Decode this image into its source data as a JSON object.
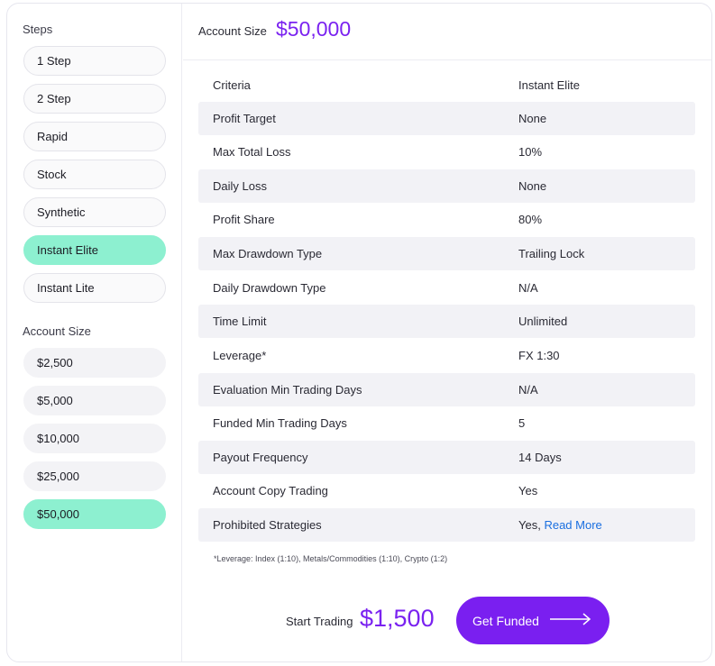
{
  "sidebar": {
    "steps_label": "Steps",
    "steps": [
      {
        "label": "1 Step",
        "active": false
      },
      {
        "label": "2 Step",
        "active": false
      },
      {
        "label": "Rapid",
        "active": false
      },
      {
        "label": "Stock",
        "active": false
      },
      {
        "label": "Synthetic",
        "active": false
      },
      {
        "label": "Instant Elite",
        "active": true
      },
      {
        "label": "Instant Lite",
        "active": false
      }
    ],
    "sizes_label": "Account Size",
    "sizes": [
      {
        "label": "$2,500",
        "active": false
      },
      {
        "label": "$5,000",
        "active": false
      },
      {
        "label": "$10,000",
        "active": false
      },
      {
        "label": "$25,000",
        "active": false
      },
      {
        "label": "$50,000",
        "active": true
      }
    ]
  },
  "header": {
    "label": "Account Size",
    "value": "$50,000"
  },
  "table": {
    "rows": [
      {
        "key": "Criteria",
        "value": "Instant Elite"
      },
      {
        "key": "Profit Target",
        "value": "None"
      },
      {
        "key": "Max Total Loss",
        "value": "10%"
      },
      {
        "key": "Daily Loss",
        "value": "None"
      },
      {
        "key": "Profit Share",
        "value": "80%"
      },
      {
        "key": "Max Drawdown Type",
        "value": "Trailing Lock"
      },
      {
        "key": "Daily Drawdown Type",
        "value": "N/A"
      },
      {
        "key": "Time Limit",
        "value": "Unlimited"
      },
      {
        "key": "Leverage*",
        "value": "FX 1:30"
      },
      {
        "key": "Evaluation Min Trading Days",
        "value": "N/A"
      },
      {
        "key": "Funded Min Trading Days",
        "value": "5"
      },
      {
        "key": "Payout Frequency",
        "value": "14 Days"
      },
      {
        "key": "Account Copy Trading",
        "value": "Yes"
      },
      {
        "key": "Prohibited Strategies",
        "value": "Yes,",
        "link": "Read More"
      }
    ]
  },
  "footnote": "*Leverage: Index (1:10), Metals/Commodities (1:10), Crypto (1:2)",
  "footer": {
    "start_label": "Start Trading",
    "price": "$1,500",
    "cta_label": "Get Funded",
    "cta_icon": "arrow-right-icon"
  },
  "colors": {
    "accent": "#7a22f0",
    "active_pill": "#8df0d0",
    "link": "#1a6fe0",
    "row_shade": "#f2f2f6"
  }
}
